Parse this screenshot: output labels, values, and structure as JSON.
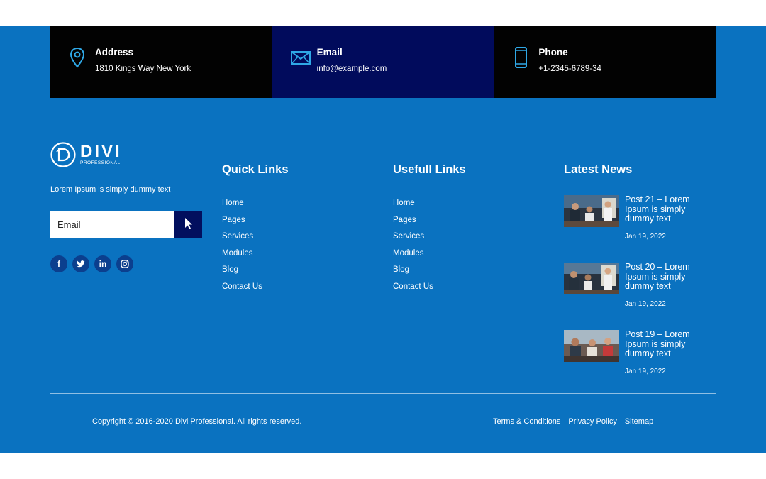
{
  "contacts": [
    {
      "title": "Address",
      "value": "1810 Kings Way New York",
      "icon": "map-pin-icon"
    },
    {
      "title": "Email",
      "value": "info@example.com",
      "icon": "envelope-icon"
    },
    {
      "title": "Phone",
      "value": "+1-2345-6789-34",
      "icon": "phone-icon"
    }
  ],
  "brand": {
    "logo_word": "DIVI",
    "logo_sub": "PROFESSIONAL",
    "tagline": "Lorem Ipsum is simply dummy text",
    "email_placeholder": "Email",
    "submit_icon": "cursor-arrow-icon",
    "socials": [
      {
        "name": "facebook",
        "glyph": "f"
      },
      {
        "name": "twitter",
        "glyph": "t"
      },
      {
        "name": "linkedin",
        "glyph": "in"
      },
      {
        "name": "instagram",
        "glyph": "o"
      }
    ]
  },
  "quick_links": {
    "heading": "Quick Links",
    "items": [
      "Home",
      "Pages",
      "Services",
      "Modules",
      "Blog",
      "Contact Us"
    ]
  },
  "usefull_links": {
    "heading": "Usefull Links",
    "items": [
      "Home",
      "Pages",
      "Services",
      "Modules",
      "Blog",
      "Contact Us"
    ]
  },
  "latest_news": {
    "heading": "Latest News",
    "items": [
      {
        "title": "Post 21 – Lorem Ipsum is simply dummy text",
        "date": "Jan 19, 2022"
      },
      {
        "title": "Post 20 – Lorem Ipsum is simply dummy text",
        "date": "Jan 19, 2022"
      },
      {
        "title": "Post 19 – Lorem Ipsum is simply dummy text",
        "date": "Jan 19, 2022"
      }
    ]
  },
  "bottom": {
    "copyright": "Copyright © 2016-2020 Divi Professional. All rights reserved.",
    "links": [
      "Terms & Conditions",
      "Privacy Policy",
      "Sitemap"
    ]
  },
  "colors": {
    "footer_bg": "#0a72c0",
    "contact_dark": "#020202",
    "contact_navy": "#010b5c",
    "icon_accent": "#2fa8e6"
  }
}
